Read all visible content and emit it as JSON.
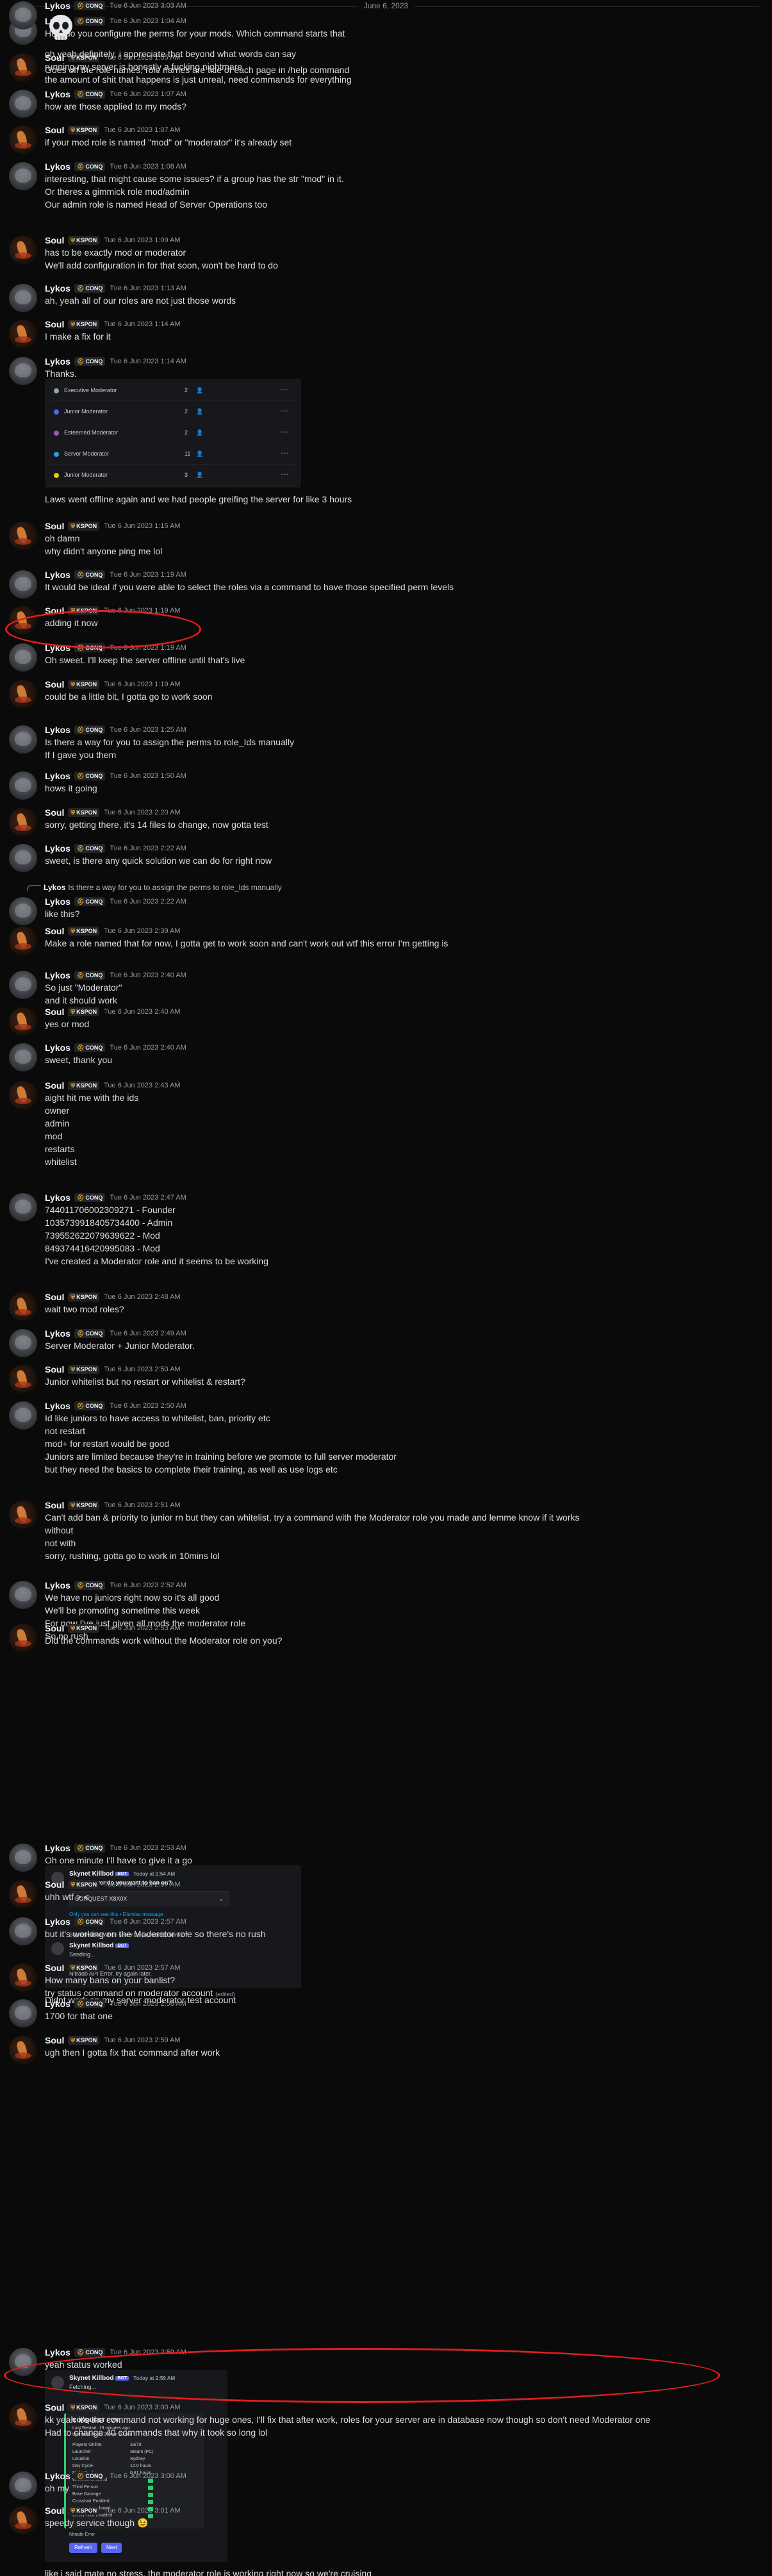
{
  "date_divider": "June 6, 2023",
  "users": {
    "lykos": {
      "name": "Lykos",
      "tag": "CONQ",
      "tag_icon": "helmet-icon"
    },
    "soul": {
      "name": "Soul",
      "tag": "KSPON",
      "tag_icon": "shield-icon"
    }
  },
  "messages": [
    {
      "author": "Lykos",
      "tag": "CONQ",
      "time": "Tue 6 Jun 2023 1:04 AM",
      "lines": [
        "How do you configure the perms for your mods. Which command starts that"
      ]
    },
    {
      "author": "Soul",
      "tag": "KSPON",
      "time": "Tue 6 Jun 2023 1:05 AM",
      "lines": [
        "Goes off the role names, role names are title of each page in /help command"
      ]
    },
    {
      "author": "Lykos",
      "tag": "CONQ",
      "time": "Tue 6 Jun 2023 1:07 AM",
      "lines": [
        "how are those applied to my mods?"
      ]
    },
    {
      "author": "Soul",
      "tag": "KSPON",
      "time": "Tue 6 Jun 2023 1:07 AM",
      "lines": [
        "if your mod role is named \"mod\" or \"moderator\" it's already set"
      ]
    },
    {
      "author": "Lykos",
      "tag": "CONQ",
      "time": "Tue 6 Jun 2023 1:08 AM",
      "lines": [
        "interesting, that might cause some issues? if a group has the str \"mod\" in it.",
        "Or theres a gimmick role mod/admin",
        "Our admin role is named Head of Server Operations too"
      ]
    },
    {
      "author": "Soul",
      "tag": "KSPON",
      "time": "Tue 6 Jun 2023 1:09 AM",
      "lines": [
        "has to be exactly mod or moderator",
        "We'll add configuration in for that soon, won't be hard to do"
      ]
    },
    {
      "author": "Lykos",
      "tag": "CONQ",
      "time": "Tue 6 Jun 2023 1:13 AM",
      "lines": [
        "ah, yeah all of our roles are not just those words"
      ]
    },
    {
      "author": "Soul",
      "tag": "KSPON",
      "time": "Tue 6 Jun 2023 1:14 AM",
      "lines": [
        "I make a fix for it"
      ]
    },
    {
      "author": "Lykos",
      "tag": "CONQ",
      "time": "Tue 6 Jun 2023 1:14 AM",
      "lines": [
        "Thanks.",
        "Laws went offline again and we had people greifing the server for like 3 hours"
      ],
      "roles": [
        {
          "name": "Executive Moderator",
          "count": "2",
          "color": "#9aa0a6"
        },
        {
          "name": "Junior Moderator",
          "count": "2",
          "color": "#5865f2"
        },
        {
          "name": "Esteemed Moderator",
          "count": "2",
          "color": "#9b59b6"
        },
        {
          "name": "Server Moderator",
          "count": "11",
          "color": "#3498db"
        },
        {
          "name": "Junior Moderator",
          "count": "3",
          "color": "#f1c40f"
        }
      ]
    },
    {
      "author": "Soul",
      "tag": "KSPON",
      "time": "Tue 6 Jun 2023 1:15 AM",
      "lines": [
        "oh damn",
        "why didn't anyone ping me lol"
      ]
    },
    {
      "author": "Lykos",
      "tag": "CONQ",
      "time": "Tue 6 Jun 2023 1:19 AM",
      "lines": [
        "It would be ideal if you were able to select the roles via a command to have those specified perm levels"
      ]
    },
    {
      "author": "Soul",
      "tag": "KSPON",
      "time": "Tue 6 Jun 2023 1:19 AM",
      "lines": [
        "adding it now"
      ]
    },
    {
      "author": "Lykos",
      "tag": "CONQ",
      "time": "Tue 6 Jun 2023 1:19 AM",
      "lines": [
        "Oh sweet. I'll keep the server offline until that's live"
      ]
    },
    {
      "author": "Soul",
      "tag": "KSPON",
      "time": "Tue 6 Jun 2023 1:19 AM",
      "lines": [
        "could be a little bit, I gotta go to work soon"
      ]
    },
    {
      "author": "Lykos",
      "tag": "CONQ",
      "time": "Tue 6 Jun 2023 1:25 AM",
      "lines": [
        "Is there a way for you to assign the perms to role_Ids manually",
        "If I gave you them"
      ]
    },
    {
      "author": "Lykos",
      "tag": "CONQ",
      "time": "Tue 6 Jun 2023 1:50 AM",
      "lines": [
        "hows it going"
      ]
    },
    {
      "author": "Soul",
      "tag": "KSPON",
      "time": "Tue 6 Jun 2023 2:20 AM",
      "lines": [
        "sorry, getting there, it's 14 files to change, now gotta test"
      ]
    },
    {
      "author": "Lykos",
      "tag": "CONQ",
      "time": "Tue 6 Jun 2023 2:22 AM",
      "lines": [
        "sweet, is there any quick solution we can do for right now"
      ]
    },
    {
      "author": "Lykos",
      "tag": "CONQ",
      "time": "Tue 6 Jun 2023 2:22 AM",
      "reply": "Is there a way for you to assign the perms to role_Ids manually",
      "lines": [
        "like this?"
      ]
    },
    {
      "author": "Soul",
      "tag": "KSPON",
      "time": "Tue 6 Jun 2023 2:39 AM",
      "lines": [
        "Make a role named that for now, I gotta get to work soon and can't work out wtf this error I'm getting is"
      ]
    },
    {
      "author": "Lykos",
      "tag": "CONQ",
      "time": "Tue 6 Jun 2023 2:40 AM",
      "lines": [
        "So just \"Moderator\"",
        "and it should work"
      ]
    },
    {
      "author": "Soul",
      "tag": "KSPON",
      "time": "Tue 6 Jun 2023 2:40 AM",
      "lines": [
        "yes or mod"
      ]
    },
    {
      "author": "Lykos",
      "tag": "CONQ",
      "time": "Tue 6 Jun 2023 2:40 AM",
      "lines": [
        "sweet, thank you"
      ]
    },
    {
      "author": "Soul",
      "tag": "KSPON",
      "time": "Tue 6 Jun 2023 2:43 AM",
      "lines": [
        "aight hit me with the ids",
        "owner",
        "admin",
        "mod",
        "restarts",
        "whitelist"
      ]
    },
    {
      "author": "Lykos",
      "tag": "CONQ",
      "time": "Tue 6 Jun 2023 2:47 AM",
      "lines": [
        "744011706002309271 - Founder",
        "1035739918405734400 - Admin",
        "739552622079639622 - Mod",
        "849374416420995083 - Mod",
        "I've created a Moderator role and it seems to be working"
      ]
    },
    {
      "author": "Soul",
      "tag": "KSPON",
      "time": "Tue 6 Jun 2023 2:48 AM",
      "lines": [
        "wait two mod roles?"
      ]
    },
    {
      "author": "Lykos",
      "tag": "CONQ",
      "time": "Tue 6 Jun 2023 2:49 AM",
      "lines": [
        "Server Moderator + Junior Moderator."
      ]
    },
    {
      "author": "Soul",
      "tag": "KSPON",
      "time": "Tue 6 Jun 2023 2:50 AM",
      "lines": [
        "Junior whitelist but no restart or whitelist & restart?"
      ]
    },
    {
      "author": "Lykos",
      "tag": "CONQ",
      "time": "Tue 6 Jun 2023 2:50 AM",
      "lines": [
        "Id like juniors to have access to whitelist, ban, priority etc",
        "not restart",
        "mod+ for restart would be good",
        "Juniors are limited because they're in training before we promote to full server moderator",
        "but they need the basics to complete their training, as well as use logs etc"
      ]
    },
    {
      "author": "Soul",
      "tag": "KSPON",
      "time": "Tue 6 Jun 2023 2:51 AM",
      "lines": [
        "Can't add ban & priority to junior rn but they can whitelist, try a command with the Moderator role you made and lemme know if it works",
        "without",
        "not with",
        "sorry, rushing, gotta go to work in 10mins lol"
      ]
    },
    {
      "author": "Lykos",
      "tag": "CONQ",
      "time": "Tue 6 Jun 2023 2:52 AM",
      "lines": [
        "We have no juniors right now so it's all good",
        "We'll be promoting sometime this week",
        "For now I've just given all mods the moderator role",
        "So no rush"
      ]
    },
    {
      "author": "Soul",
      "tag": "KSPON",
      "time": "Tue 6 Jun 2023 2:53 AM",
      "lines": [
        "Did the commands work without the Moderator role on you?"
      ]
    },
    {
      "author": "Lykos",
      "tag": "CONQ",
      "time": "Tue 6 Jun 2023 2:53 AM",
      "lines": [
        "Oh one minute I'll have to give it a go",
        "Didnt work on my server moderator test account"
      ],
      "ban_embed": {
        "bot_name": "Skynet Killbod",
        "bot_tag": "BOT",
        "bot_time": "Today at 2:54 AM",
        "question": "Which server do you want to ban on?",
        "selected": "CONQUEST X8X0X",
        "hint": "Only you can see this • Dismiss message",
        "reply_ref": "Skynet Killbod Which server do you want to ban on?",
        "status1": "Sending...",
        "status2": "Nitrado API Error, try again later."
      }
    },
    {
      "author": "Soul",
      "tag": "KSPON",
      "time": "Tue 6 Jun 2023 2:57 AM",
      "lines": [
        "uhh wtf >.<"
      ]
    },
    {
      "author": "Lykos",
      "tag": "CONQ",
      "time": "Tue 6 Jun 2023 2:57 AM",
      "lines": [
        "but it's working on the Moderator role so there's no rush"
      ]
    },
    {
      "author": "Soul",
      "tag": "KSPON",
      "time": "Tue 6 Jun 2023 2:57 AM",
      "lines": [
        "How many bans on your banlist?",
        "try status command on moderator account"
      ],
      "edited": "(edited)"
    },
    {
      "author": "Lykos",
      "tag": "CONQ",
      "time": "Tue 6 Jun 2023 2:58 AM",
      "lines": [
        "1700 for that one"
      ]
    },
    {
      "author": "Soul",
      "tag": "KSPON",
      "time": "Tue 6 Jun 2023 2:59 AM",
      "lines": [
        "ugh then I gotta fix that command after work"
      ]
    },
    {
      "author": "Lykos",
      "tag": "CONQ",
      "time": "Tue 6 Jun 2023 2:59 AM",
      "lines": [
        "yeah status worked",
        "like i said mate no stress, the moderator role is working right now so we're cruising"
      ],
      "status_embed": {
        "bot_name": "Skynet Killbod",
        "bot_tag": "BOT",
        "bot_time": "Today at 2:59 AM",
        "fetching": "Fetching...",
        "title": "CONQUEST PVN",
        "sub1": "Last Restart: 19 minutes ago",
        "sub2": "Uptime 8 hours 36 min 20 sec",
        "rows": [
          {
            "label": "Players Online",
            "value": "33/70"
          },
          {
            "label": "Launcher",
            "value": "Steam (PC)"
          },
          {
            "label": "Location",
            "value": "Sydney"
          },
          {
            "label": "Day Cycle",
            "value": "12.0 hours"
          },
          {
            "label": "Night Cycle",
            "value": "0.81 hours"
          },
          {
            "label": "Whitelist Enabled",
            "value": ""
          },
          {
            "label": "Third Person",
            "value": ""
          },
          {
            "label": "Base Damage",
            "value": ""
          },
          {
            "label": "Crosshair Enabled",
            "value": ""
          },
          {
            "label": "Mouse & Keyboard",
            "value": ""
          },
          {
            "label": "Cross Host Enabled",
            "value": ""
          }
        ],
        "footer": "Nitrado Error",
        "btn1": "Refresh",
        "btn2": "Next"
      }
    },
    {
      "author": "Soul",
      "tag": "KSPON",
      "time": "Tue 6 Jun 2023 3:00 AM",
      "lines": [
        "kk yeah it's the command not working for huge ones, I'll fix that after work, roles for your server are in database now though so don't need Moderator one",
        "Had to change 40 commands that why it took so long lol"
      ]
    },
    {
      "author": "Lykos",
      "tag": "CONQ",
      "time": "Tue 6 Jun 2023 3:00 AM",
      "lines": [
        "oh my"
      ],
      "skull": "skull-emoji"
    },
    {
      "author": "Soul",
      "tag": "KSPON",
      "time": "Tue 6 Jun 2023 3:01 AM",
      "lines": [
        "speedy service though 😉"
      ]
    },
    {
      "author": "Lykos",
      "tag": "CONQ",
      "time": "Tue 6 Jun 2023 3:03 AM",
      "lines": [
        "oh yeah definitely, i appreciate that beyond what words can say",
        "running my server is honestly a fucking nightmare",
        "the amount of shit that happens is just unreal, need commands for everything"
      ]
    }
  ],
  "highlight_color": "#e01f1f"
}
